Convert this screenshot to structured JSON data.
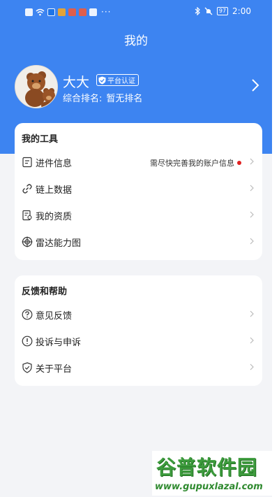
{
  "status_bar": {
    "time": "2:00",
    "battery": "97",
    "more": "···"
  },
  "header": {
    "title": "我的"
  },
  "profile": {
    "name": "大大",
    "badge": "平台认证",
    "rank_label": "综合排名:",
    "rank_value": "暂无排名"
  },
  "tools": {
    "title": "我的工具",
    "items": [
      {
        "label": "进件信息",
        "icon": "document-icon",
        "hint": "需尽快完善我的账户信息"
      },
      {
        "label": "链上数据",
        "icon": "link-icon"
      },
      {
        "label": "我的资质",
        "icon": "certificate-icon"
      },
      {
        "label": "雷达能力图",
        "icon": "radar-icon"
      }
    ]
  },
  "help": {
    "title": "反馈和帮助",
    "items": [
      {
        "label": "意见反馈",
        "icon": "question-circle-icon"
      },
      {
        "label": "投诉与申诉",
        "icon": "exclamation-circle-icon"
      },
      {
        "label": "关于平台",
        "icon": "shield-check-icon"
      }
    ]
  },
  "watermark": {
    "name": "谷普软件园",
    "url": "www.gupuxlazal.com"
  },
  "colors": {
    "accent": "#3d84f1",
    "background": "#f3f4f7",
    "alert_dot": "#e02020"
  }
}
